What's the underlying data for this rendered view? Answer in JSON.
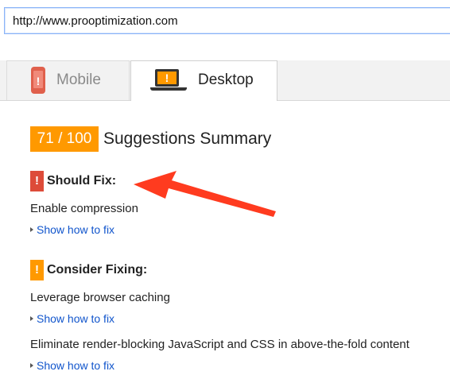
{
  "url_bar": {
    "value": "http://www.prooptimization.com"
  },
  "tabs": [
    {
      "label": "Mobile",
      "icon": "phone-icon",
      "active": false
    },
    {
      "label": "Desktop",
      "icon": "laptop-icon",
      "active": true
    }
  ],
  "summary": {
    "score": "71 / 100",
    "title": "Suggestions Summary",
    "score_color": "#ff9900"
  },
  "should_fix": {
    "heading": "Should Fix:",
    "flag_color": "#dd4b39",
    "items": [
      {
        "text": "Enable compression",
        "link": "Show how to fix"
      }
    ]
  },
  "consider_fixing": {
    "heading": "Consider Fixing:",
    "flag_color": "#ff9900",
    "items": [
      {
        "text": "Leverage browser caching",
        "link": "Show how to fix"
      },
      {
        "text": "Eliminate render-blocking JavaScript and CSS in above-the-fold content",
        "link": "Show how to fix"
      }
    ]
  },
  "annotation": {
    "arrow_color": "#ff3b1f"
  },
  "flag_mark": "!"
}
